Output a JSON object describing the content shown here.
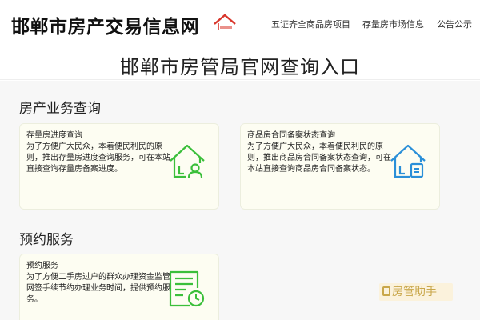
{
  "header": {
    "site_title": "邯郸市房产交易信息网",
    "nav": [
      "五证齐全商品房项目",
      "存量房市场信息",
      "公告公示"
    ]
  },
  "banner": {
    "title": "邯郸市房管局官网查询入口"
  },
  "sections": [
    {
      "title": "房产业务查询",
      "cards": [
        {
          "title": "存量房进度查询",
          "desc": "为了方便广大民众，本着便民利民的原则，推出存量房进度查询服务，可在本站直接查询存量房备案进度。",
          "icon": "house-person-icon"
        },
        {
          "title": "商品房合同备案状态查询",
          "desc": "为了方便广大民众，本着便民利民的原则，推出商品房合同备案状态查询，可在本站直接查询商品房合同备案状态。",
          "icon": "house-document-icon"
        }
      ]
    },
    {
      "title": "预约服务",
      "cards": [
        {
          "title": "预约服务",
          "desc": "为了方便二手房过户的群众办理资金监管网签手续节约办理业务时间，提供预约服务。",
          "icon": "form-clock-icon"
        }
      ]
    }
  ],
  "watermark": {
    "text": "房管助手"
  },
  "colors": {
    "accent_green": "#3bbf3b",
    "accent_blue": "#2a8fd8",
    "logo_red": "#d9362b"
  }
}
